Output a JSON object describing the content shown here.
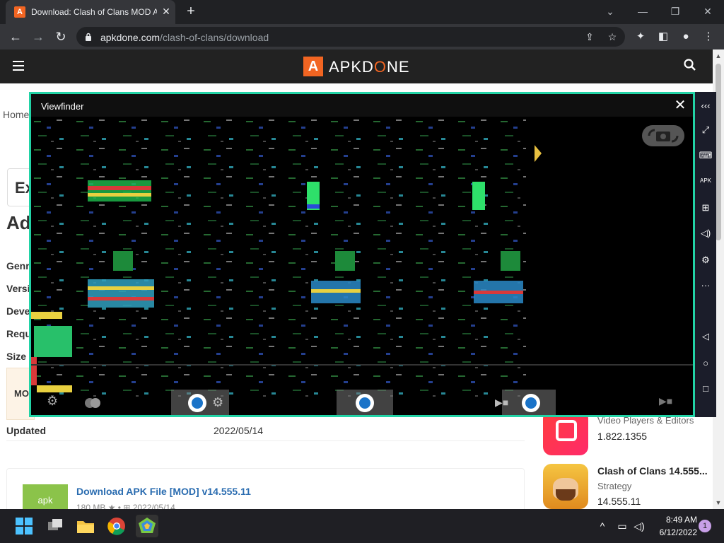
{
  "browser": {
    "tab_title": "Download: Clash of Clans MOD APK",
    "tab_favicon_letter": "A",
    "url_host": "apkdone.com",
    "url_path": "/clash-of-clans/download"
  },
  "site": {
    "logo_letter": "A",
    "logo_text_a": "APKD",
    "logo_text_o": "O",
    "logo_text_b": "NE",
    "breadcrumb": "Home",
    "ex_text": "Ex",
    "ad_title": "Ad",
    "info_labels": [
      "Genr",
      "Versi",
      "Deve",
      "Requ",
      "Size"
    ],
    "mod_label": "MO",
    "updated_label": "Updated",
    "updated_value": "2022/05/14",
    "download": {
      "icon_label": "apk",
      "title": "Download APK File [MOD] v14.555.11",
      "meta": "180 MB ★ • ⊞ 2022/05/14"
    },
    "sidebar_apps": [
      {
        "name": "",
        "category": "Video Players & Editors",
        "version": "1.822.1355"
      },
      {
        "name": "Clash of Clans 14.555...",
        "category": "Strategy",
        "version": "14.555.11"
      }
    ]
  },
  "viewfinder": {
    "title": "Viewfinder",
    "close": "✕"
  },
  "emulator_icons": [
    "chevrons-left-icon",
    "fullscreen-icon",
    "keyboard-icon",
    "apk-icon",
    "add-window-icon",
    "volume-icon",
    "gear-icon",
    "more-icon",
    "back-icon",
    "home-icon",
    "recents-icon"
  ],
  "taskbar": {
    "time": "8:49 AM",
    "date": "6/12/2022",
    "notification_count": "1"
  },
  "colors": {
    "accent": "#f26522",
    "viewfinder_border": "#22d3a6"
  }
}
